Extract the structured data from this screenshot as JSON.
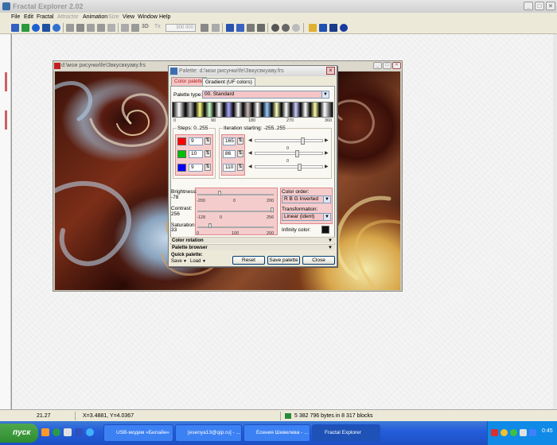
{
  "app": {
    "title": "Fractal Explorer 2.02"
  },
  "menu": [
    "File",
    "Edit",
    "Fractal",
    "Attractor",
    "Animation",
    "Size",
    "View",
    "Window",
    "Help"
  ],
  "toolbar": {
    "zoom_value": "300 000",
    "text_button": "3D",
    "tx_button": "Tx"
  },
  "fractal_window": {
    "title": "d:\\мои рисунки\\fe\\Звкусвкуаву.frs"
  },
  "palette": {
    "title": "Palette: d:\\мои рисунки\\fe\\Звкусвкуаву.frs",
    "tabs": [
      "Color palette",
      "Gradient (UF colors)"
    ],
    "palette_type_label": "Palette type:",
    "palette_type_value": "00. Standard",
    "strip_ticks": [
      "0",
      "90",
      "180",
      "270",
      "360"
    ],
    "steps_label": "Steps: 0..255",
    "iter_label": "Iteration starting: -255..255",
    "steps": [
      "9",
      "10",
      "9"
    ],
    "iterations": [
      "165",
      "86",
      "110"
    ],
    "slider_zero": "0",
    "swatch_colors": [
      "#ff0000",
      "#00c000",
      "#0000ff"
    ],
    "brightness_label": "Brightness:",
    "brightness_value": "-78",
    "brightness_scale": [
      "-200",
      "0",
      "200"
    ],
    "contrast_label": "Contrast:",
    "contrast_value": "256",
    "contrast_scale": [
      "-128",
      "0",
      "256"
    ],
    "saturation_label": "Saturation",
    "saturation_value": "33",
    "saturation_scale": [
      "0",
      "100",
      "200"
    ],
    "color_order_label": "Color order:",
    "color_order_value": "R B G  Inverted",
    "transformation_label": "Transformation:",
    "transformation_value": "Linear (ident)",
    "infinity_label": "Infinity color:",
    "infinity_color": "#111111",
    "color_rotation": "Color rotation",
    "palette_browser": "Palette browser",
    "quick_palette": "Quick palette:",
    "save_menu": "Save",
    "load_menu": "Load",
    "buttons": {
      "reset": "Reset",
      "save_palette": "Save palette",
      "close": "Close"
    }
  },
  "statusbar": {
    "zoom": "21.27",
    "coords": "X=3.4881, Y=4.0367",
    "memory": "5 382 796 bytes in 8 317 blocks"
  },
  "taskbar": {
    "start": "пуск",
    "tasks": [
      "USB-модем «Билайн»",
      "[esenya13@qip.ru] - ...",
      "Есения Шевелева - ...",
      "Fractal Explorer"
    ],
    "clock": "0:45"
  }
}
